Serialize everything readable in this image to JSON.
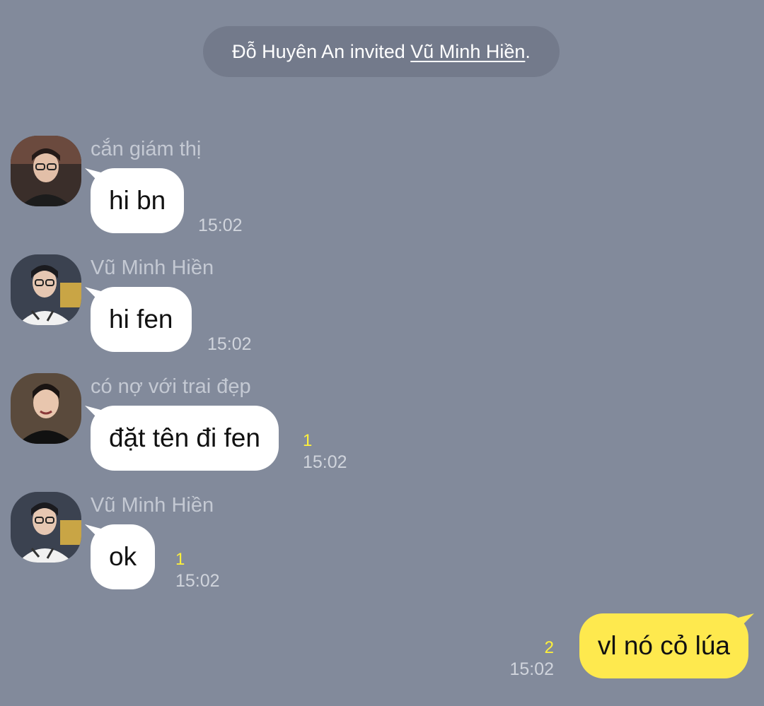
{
  "system_message": {
    "inviter": "Đỗ Huyên An",
    "action": "invited",
    "invitee": "Vũ Minh Hiền ",
    "period": "."
  },
  "messages": [
    {
      "sender": "cắn giám thị",
      "text": "hi bn",
      "unread": "",
      "time": "15:02",
      "avatar": "avatar-photo-man-glasses-dark-jacket"
    },
    {
      "sender": "Vũ Minh Hiền",
      "text": "hi fen",
      "unread": "",
      "time": "15:02",
      "avatar": "avatar-photo-man-glasses-white-jersey"
    },
    {
      "sender": "có nợ với trai đẹp",
      "text": "đặt tên đi fen",
      "unread": "1",
      "time": "15:02",
      "avatar": "avatar-photo-man-smiling-black-jacket"
    },
    {
      "sender": "Vũ Minh Hiền",
      "text": "ok",
      "unread": "1",
      "time": "15:02",
      "avatar": "avatar-photo-man-glasses-white-jersey"
    }
  ],
  "my_message": {
    "text": "vl nó cỏ lúa",
    "unread": "2",
    "time": "15:02"
  },
  "colors": {
    "background": "#828a9b",
    "system_pill": "#737a8b",
    "bubble_incoming": "#ffffff",
    "bubble_outgoing": "#fee94e",
    "unread_count": "#fff13a"
  }
}
